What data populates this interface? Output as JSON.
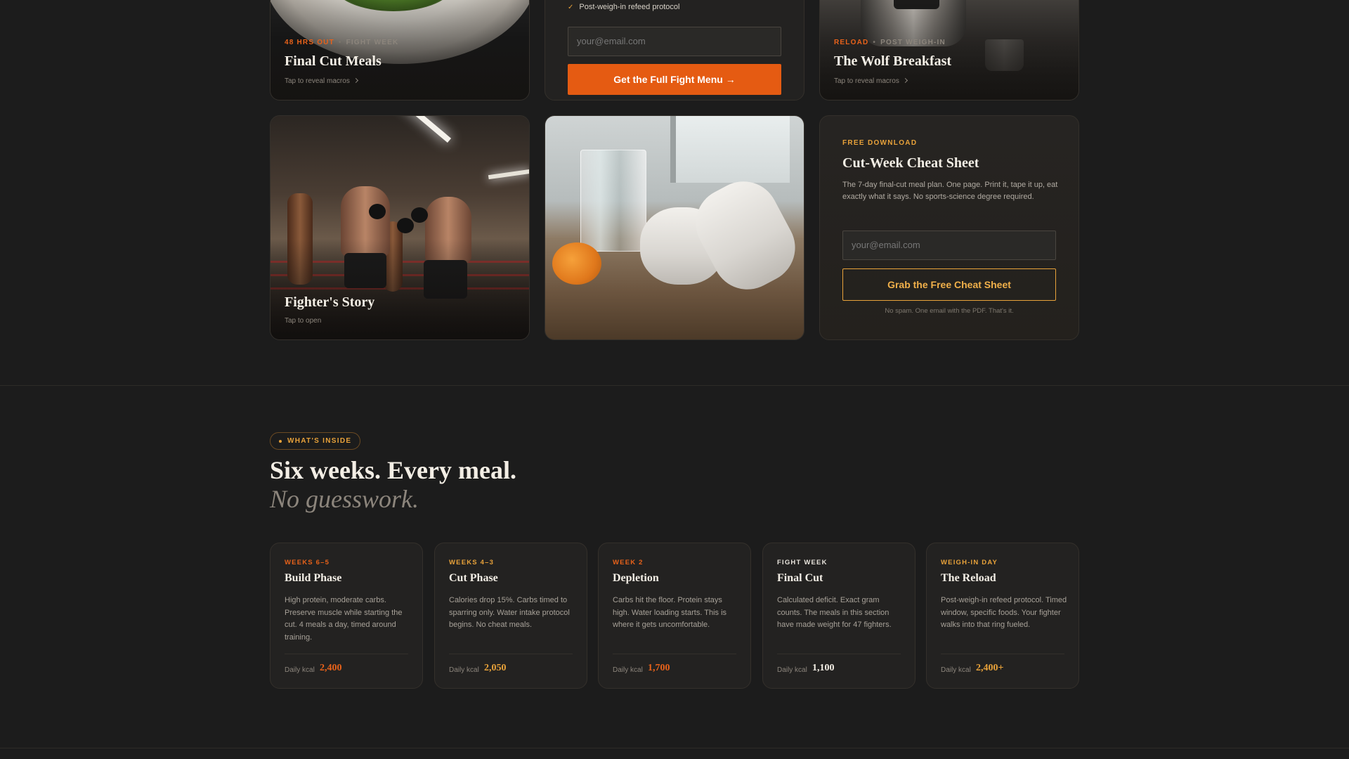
{
  "colors": {
    "accent_orange": "#e55b12",
    "accent_gold": "#e8a23a",
    "bg": "#1c1c1c",
    "card": "#232221"
  },
  "cards": {
    "final_cut": {
      "tag_primary": "48 HRS OUT",
      "tag_secondary": "FIGHT WEEK",
      "title": "Final Cut Meals",
      "sub": "Tap to reveal macros"
    },
    "fight_menu": {
      "check_item": "Post-weigh-in refeed protocol",
      "email_placeholder": "your@email.com",
      "cta": "Get the Full Fight Menu →"
    },
    "wolf": {
      "tag_primary": "RELOAD",
      "tag_secondary": "POST WEIGH-IN",
      "title": "The Wolf Breakfast",
      "sub": "Tap to reveal macros"
    },
    "fighter_story": {
      "title": "Fighter's Story",
      "sub": "Tap to open"
    },
    "cheat_sheet": {
      "label": "FREE DOWNLOAD",
      "title": "Cut-Week Cheat Sheet",
      "desc": "The 7-day final-cut meal plan. One page. Print it, tape it up, eat exactly what it says. No sports-science degree required.",
      "email_placeholder": "your@email.com",
      "cta": "Grab the Free Cheat Sheet",
      "fine": "No spam. One email with the PDF. That's it."
    }
  },
  "section": {
    "pill": "WHAT'S INSIDE",
    "heading": "Six weeks. Every meal.",
    "heading_italic": "No guesswork.",
    "kcal_label": "Daily kcal",
    "weeks": [
      {
        "label": "WEEKS 6–5",
        "title": "Build Phase",
        "desc": "High protein, moderate carbs. Preserve muscle while starting the cut. 4 meals a day, timed around training.",
        "kcal": "2,400",
        "label_color": "#e8621a",
        "value_color": "#e8621a"
      },
      {
        "label": "WEEKS 4–3",
        "title": "Cut Phase",
        "desc": "Calories drop 15%. Carbs timed to sparring only. Water intake protocol begins. No cheat meals.",
        "kcal": "2,050",
        "label_color": "#e8a23a",
        "value_color": "#e8a23a"
      },
      {
        "label": "WEEK 2",
        "title": "Depletion",
        "desc": "Carbs hit the floor. Protein stays high. Water loading starts. This is where it gets uncomfortable.",
        "kcal": "1,700",
        "label_color": "#e8621a",
        "value_color": "#e8621a"
      },
      {
        "label": "FIGHT WEEK",
        "title": "Final Cut",
        "desc": "Calculated deficit. Exact gram counts. The meals in this section have made weight for 47 fighters.",
        "kcal": "1,100",
        "label_color": "#e8e4dc",
        "value_color": "#f3eee5"
      },
      {
        "label": "WEIGH-IN DAY",
        "title": "The Reload",
        "desc": "Post-weigh-in refeed protocol. Timed window, specific foods. Your fighter walks into that ring fueled.",
        "kcal": "2,400+",
        "label_color": "#e8a23a",
        "value_color": "#e8a23a"
      }
    ]
  }
}
